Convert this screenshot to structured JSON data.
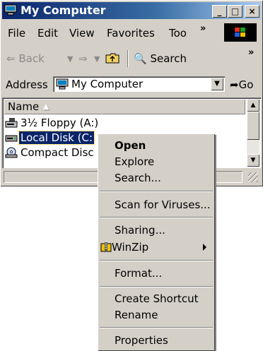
{
  "window": {
    "title": "My Computer",
    "caption_buttons": [
      "_",
      "□",
      "×"
    ]
  },
  "menubar": {
    "items": [
      "File",
      "Edit",
      "View",
      "Favorites",
      "Too"
    ],
    "chevron": "»"
  },
  "toolbar": {
    "back": "Back",
    "search": "Search",
    "chevron": "»"
  },
  "addressbar": {
    "label": "Address",
    "value": "My Computer",
    "go": "Go"
  },
  "list": {
    "column_header": "Name",
    "sort_indicator": "▲",
    "items": [
      {
        "label": "3½ Floppy (A:)",
        "icon": "floppy-drive-icon"
      },
      {
        "label": "Local Disk (C:",
        "icon": "hard-disk-icon",
        "selected": true
      },
      {
        "label": "Compact Disc",
        "icon": "cd-drive-icon"
      }
    ]
  },
  "status": {
    "text": ""
  },
  "context_menu": {
    "items": [
      "Open",
      "Explore",
      "Search...",
      "Scan for Viruses...",
      "Sharing...",
      "WinZip",
      "Format...",
      "Create Shortcut",
      "Rename",
      "Properties"
    ]
  },
  "colors": {
    "title_gradient_start": "#0a246a",
    "title_gradient_end": "#a6caf0",
    "selection": "#0a246a",
    "face": "#d4d0c8"
  }
}
